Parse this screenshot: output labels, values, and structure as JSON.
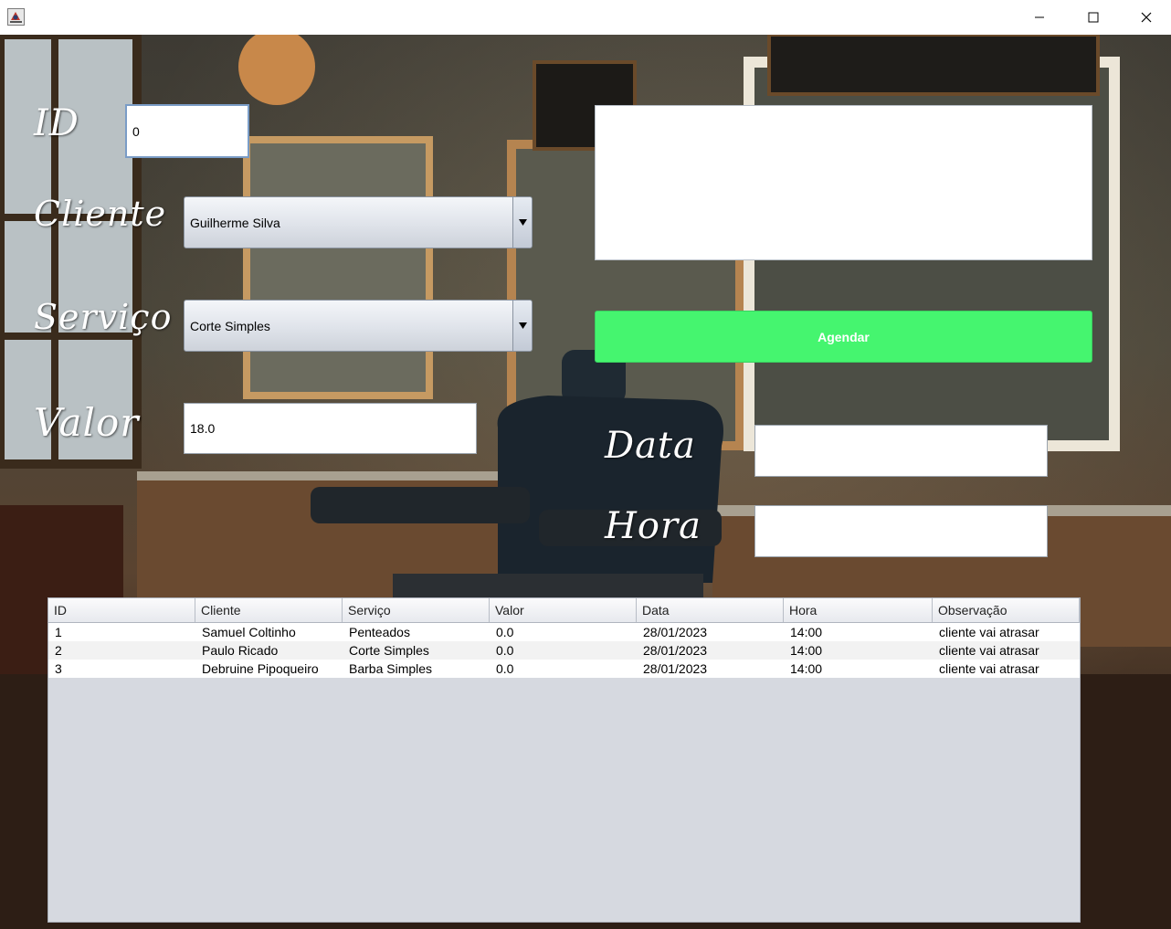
{
  "window": {
    "title": "",
    "buttons": [
      "minimize",
      "maximize",
      "close"
    ]
  },
  "form": {
    "id_label": "ID",
    "id_value": "0",
    "cliente_label": "Cliente",
    "cliente_value": "Guilherme Silva",
    "servico_label": "Serviço",
    "servico_value": "Corte Simples",
    "valor_label": "Valor",
    "valor_value": "18.0",
    "observacao_value": "",
    "agendar_label": "Agendar",
    "data_label": "Data",
    "data_value": "",
    "hora_label": "Hora",
    "hora_value": ""
  },
  "table": {
    "columns": [
      "ID",
      "Cliente",
      "Serviço",
      "Valor",
      "Data",
      "Hora",
      "Observação"
    ],
    "rows": [
      [
        "1",
        "Samuel Coltinho",
        "Penteados",
        "0.0",
        "28/01/2023",
        "14:00",
        "cliente vai atrasar"
      ],
      [
        "2",
        "Paulo Ricado",
        "Corte Simples",
        "0.0",
        "28/01/2023",
        "14:00",
        "cliente vai atrasar"
      ],
      [
        "3",
        "Debruine Pipoqueiro",
        "Barba Simples",
        "0.0",
        "28/01/2023",
        "14:00",
        "cliente vai atrasar"
      ]
    ]
  },
  "colors": {
    "agendar_button": "#45f56f",
    "table_background": "#d6d9e0"
  },
  "icons": {
    "app": "java-app-icon",
    "minimize": "minimize-icon",
    "maximize": "maximize-icon",
    "close": "close-icon",
    "dropdown": "chevron-down-icon"
  }
}
